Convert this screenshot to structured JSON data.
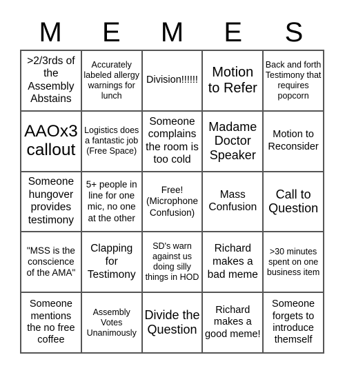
{
  "header": {
    "letters": [
      "M",
      "E",
      "M",
      "E",
      "S"
    ]
  },
  "board": {
    "rows": [
      [
        ">2/3rds of the Assembly Abstains",
        "Accurately labeled allergy warnings for lunch",
        "Division!!!!!!",
        "Motion to Refer",
        "Back and forth Testimony that requires popcorn"
      ],
      [
        "AAOx3 callout",
        "Logistics does a fantastic job (Free Space)",
        "Someone complains the room is too cold",
        "Madame Doctor Speaker",
        "Motion to Reconsider"
      ],
      [
        "Someone hungover provides testimony",
        "5+ people in line for one mic, no one at the other",
        "Free! (Microphone Confusion)",
        "Mass Confusion",
        "Call to Question"
      ],
      [
        "\"MSS is the conscience of the AMA\"",
        "Clapping for Testimony",
        "SD's warn against us doing silly things in HOD",
        "Richard makes a bad meme",
        ">30 minutes spent on one business item"
      ],
      [
        "Someone mentions the no free coffee",
        "Assembly Votes Unanimously",
        "Divide the Question",
        "Richard makes a good meme!",
        "Someone forgets to introduce themself"
      ]
    ]
  }
}
